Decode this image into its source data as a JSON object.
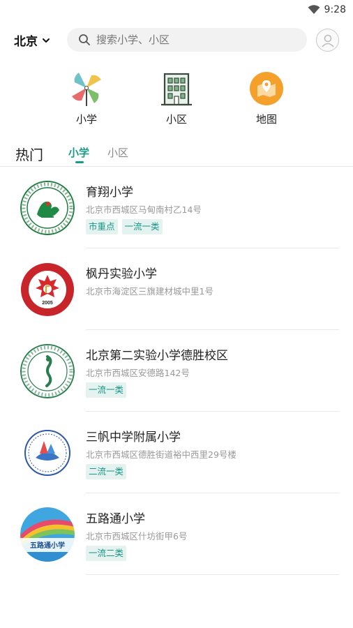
{
  "status_bar": {
    "time": "9:28"
  },
  "header": {
    "city": "北京",
    "search_placeholder": "搜索小学、小区"
  },
  "categories": [
    {
      "label": "小学",
      "icon": "pinwheel-icon"
    },
    {
      "label": "小区",
      "icon": "building-icon"
    },
    {
      "label": "地图",
      "icon": "map-icon"
    }
  ],
  "tabs": {
    "hot_label": "热门",
    "items": [
      {
        "label": "小学",
        "active": true
      },
      {
        "label": "小区",
        "active": false
      }
    ]
  },
  "schools": [
    {
      "name": "育翔小学",
      "address": "北京市西城区马甸南村乙14号",
      "tags": [
        "市重点",
        "一流一类"
      ],
      "logo_text": ""
    },
    {
      "name": "枫丹实验小学",
      "address": "北京市海淀区三旗建材城中里1号",
      "tags": [],
      "logo_text": "2005"
    },
    {
      "name": "北京第二实验小学德胜校区",
      "address": "北京市西城区安德路142号",
      "tags": [
        "一流一类"
      ],
      "logo_text": ""
    },
    {
      "name": "三帆中学附属小学",
      "address": "北京市西城区德胜街道裕中西里29号楼",
      "tags": [
        "二流一类"
      ],
      "logo_text": ""
    },
    {
      "name": "五路通小学",
      "address": "北京市西城区什坊街甲6号",
      "tags": [
        "一流二类"
      ],
      "logo_text": "五路通小学"
    }
  ],
  "colors": {
    "accent": "#1a9a86",
    "tag_bg": "#e4f3f0",
    "map_orange": "#f5a02a"
  }
}
